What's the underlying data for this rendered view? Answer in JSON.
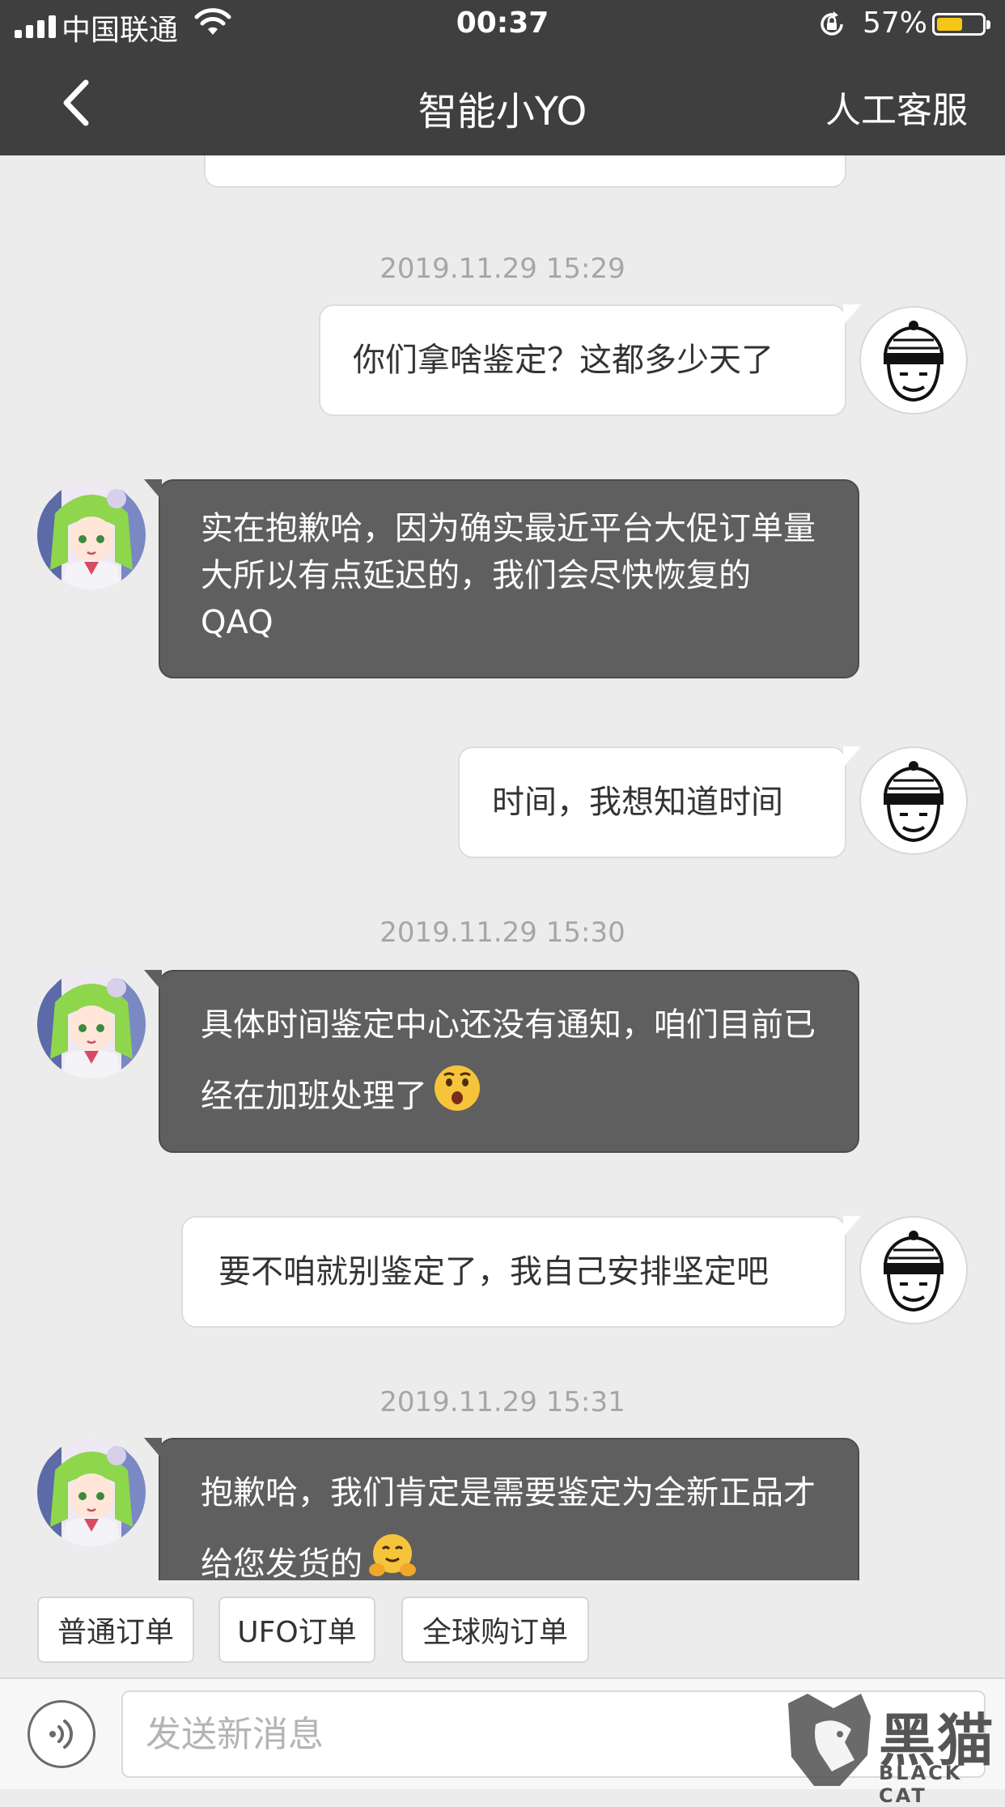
{
  "status_bar": {
    "carrier": "中国联通",
    "time": "00:37",
    "battery_pct": "57%",
    "battery_level": 0.57,
    "icons": [
      "signal-icon",
      "wifi-icon",
      "orientation-lock-icon",
      "battery-icon"
    ]
  },
  "nav": {
    "back_icon": "chevron-left-icon",
    "title": "智能小YO",
    "right_action": "人工客服"
  },
  "messages": [
    {
      "type": "partial",
      "sender": "bot"
    },
    {
      "type": "time",
      "text": "2019.11.29 15:29"
    },
    {
      "type": "msg",
      "sender": "user",
      "text": "你们拿啥鉴定？这都多少天了"
    },
    {
      "type": "msg",
      "sender": "bot",
      "text": "实在抱歉哈，因为确实最近平台大促订单量大所以有点延迟的，我们会尽快恢复的QAQ"
    },
    {
      "type": "msg",
      "sender": "user",
      "text": "时间，我想知道时间"
    },
    {
      "type": "time",
      "text": "2019.11.29 15:30"
    },
    {
      "type": "msg",
      "sender": "bot",
      "text": "具体时间鉴定中心还没有通知，咱们目前已经在加班处理了",
      "emoji": "surprised-face-emoji"
    },
    {
      "type": "msg",
      "sender": "user",
      "text": "要不咱就别鉴定了，我自己安排坚定吧"
    },
    {
      "type": "time",
      "text": "2019.11.29 15:31"
    },
    {
      "type": "msg",
      "sender": "bot",
      "text": "抱歉哈，我们肯定是需要鉴定为全新正品才给您发货的",
      "emoji": "hugging-face-emoji"
    }
  ],
  "quick_replies": [
    "普通订单",
    "UFO订单",
    "全球购订单"
  ],
  "composer": {
    "voice_icon": "voice-input-icon",
    "placeholder": "发送新消息"
  },
  "watermark": {
    "title": "黑猫",
    "subtitle": "BLACK CAT"
  },
  "colors": {
    "nav_bg": "#3f3f3f",
    "bot_bubble": "#5f5f5f",
    "user_bubble": "#ffffff",
    "chat_bg": "#ececec",
    "battery_fill": "#f5c518"
  }
}
